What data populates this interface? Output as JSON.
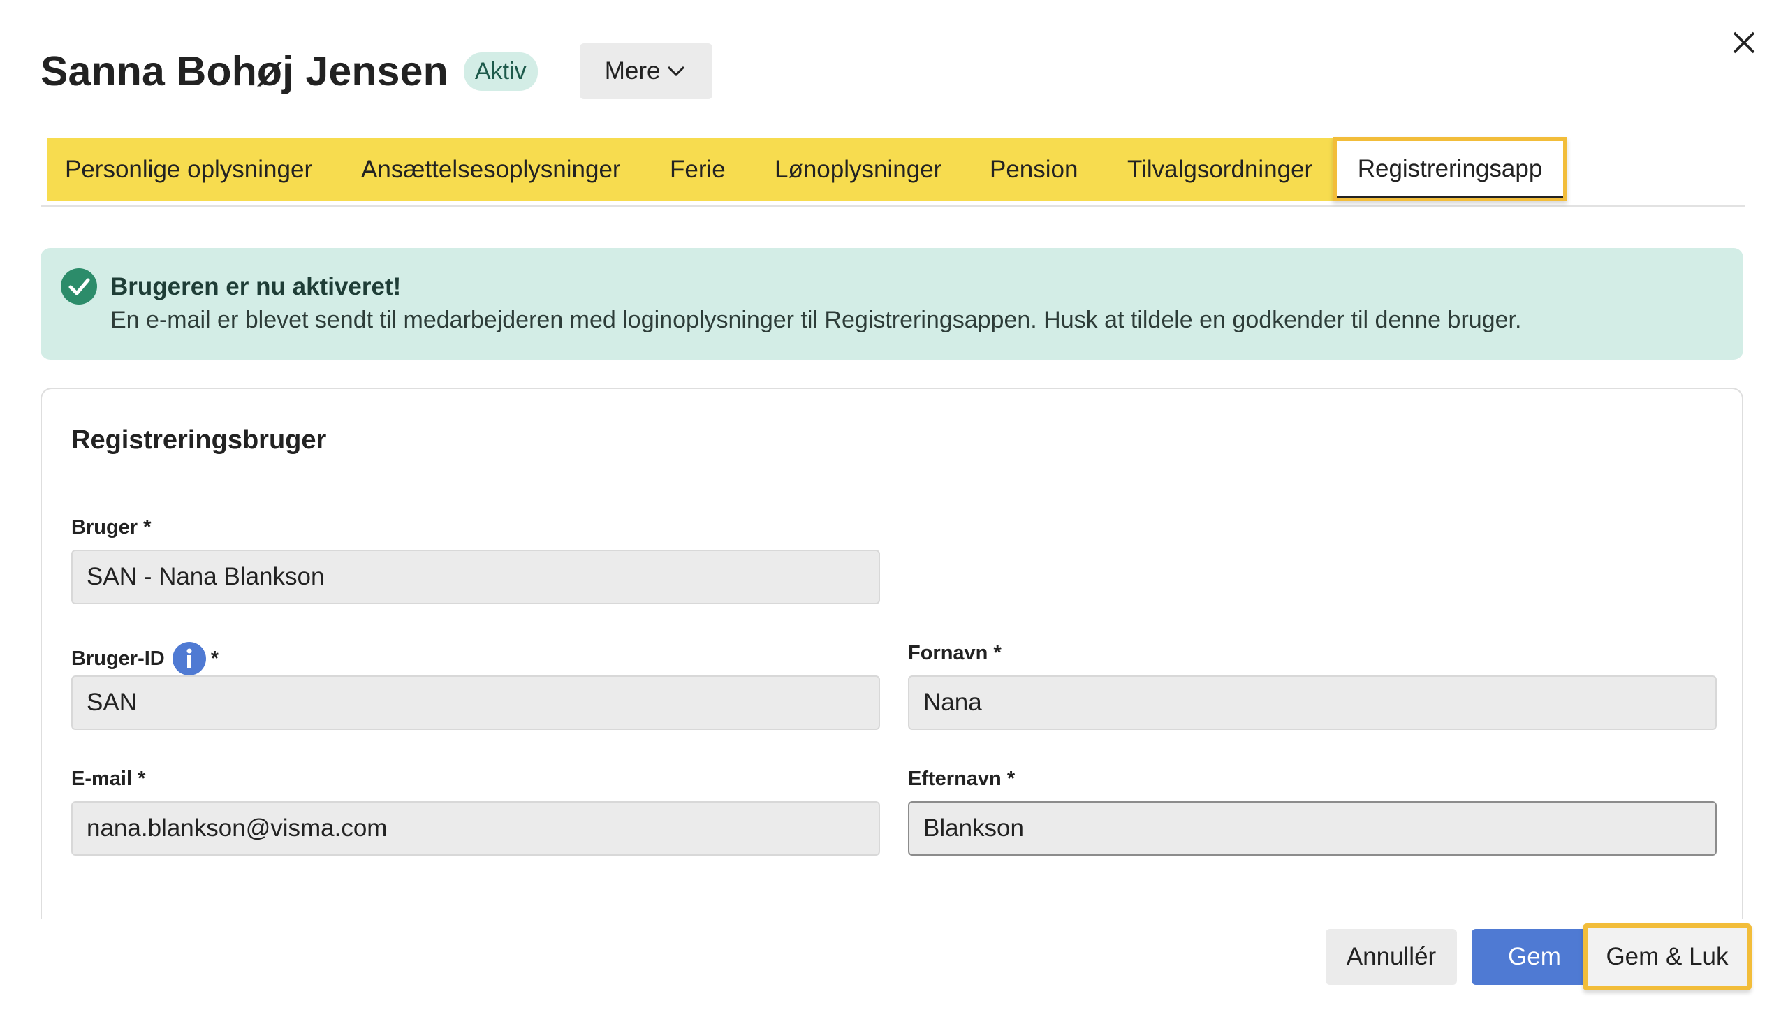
{
  "header": {
    "name": "Sanna Bohøj Jensen",
    "status_badge": "Aktiv",
    "more_button": "Mere"
  },
  "tabs": [
    {
      "label": "Personlige oplysninger"
    },
    {
      "label": "Ansættelsesoplysninger"
    },
    {
      "label": "Ferie"
    },
    {
      "label": "Lønoplysninger"
    },
    {
      "label": "Pension"
    },
    {
      "label": "Tilvalgsordninger"
    },
    {
      "label": "Registreringsapp",
      "active": true
    }
  ],
  "alert": {
    "title": "Brugeren er nu aktiveret!",
    "body": "En e-mail er blevet sendt til medarbejderen med loginoplysninger til Registreringsappen. Husk at tildele en godkender til denne bruger."
  },
  "form": {
    "section_title": "Registreringsbruger",
    "fields": {
      "bruger": {
        "label": "Bruger *",
        "value": "SAN - Nana Blankson"
      },
      "bruger_id": {
        "label": "Bruger-ID",
        "required_mark": "*",
        "value": "SAN"
      },
      "fornavn": {
        "label": "Fornavn *",
        "value": "Nana"
      },
      "email": {
        "label": "E-mail *",
        "value": "nana.blankson@visma.com"
      },
      "efternavn": {
        "label": "Efternavn *",
        "value": "Blankson"
      }
    }
  },
  "footer": {
    "cancel": "Annullér",
    "save": "Gem",
    "save_close": "Gem & Luk"
  },
  "colors": {
    "tab_bar": "#f7dc4f",
    "highlight": "#f2bd3a",
    "alert_bg": "#d3ede6",
    "success_icon": "#2c8c6a",
    "primary_button": "#4f7ad3"
  }
}
